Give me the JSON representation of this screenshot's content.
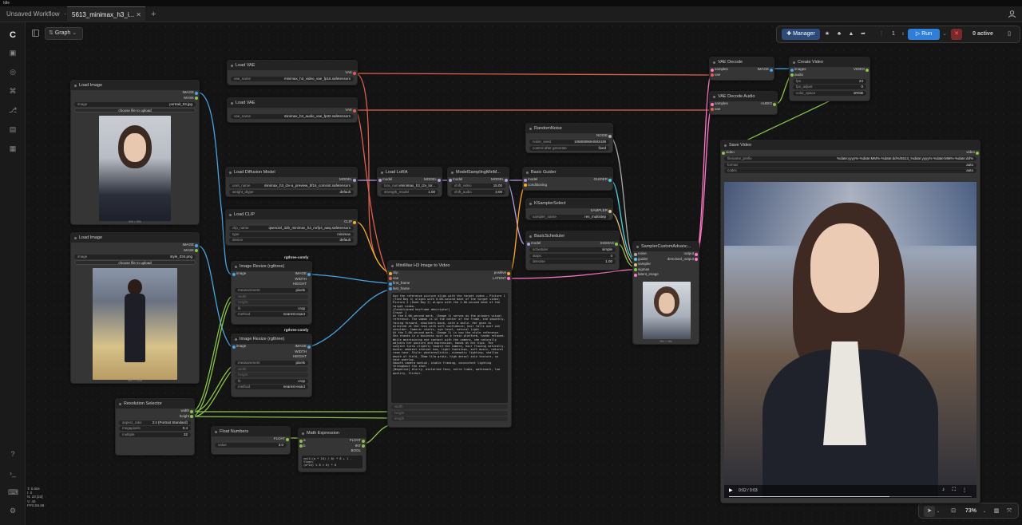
{
  "app": {
    "status": "Idle"
  },
  "tabs": [
    {
      "label": "Unsaved Workflow",
      "modified": "●"
    },
    {
      "label": "5613_minimax_h3_i...",
      "close": "✕"
    }
  ],
  "new_tab_label": "+",
  "user_icon": "user-icon",
  "canvas_toolbar": {
    "graph_label": "Graph",
    "graph_chevron": "⌄"
  },
  "top_actions": {
    "manager_label": "Manager",
    "queue_count": "1",
    "run_label": "Run",
    "active_label": "0 active"
  },
  "zoom": {
    "percent": "73%"
  },
  "stats": [
    "T: 0.00s",
    "I: 0",
    "N: 23 [23]",
    "V: 40",
    "FPS:59.88"
  ],
  "nodes": {
    "load_image_1": {
      "title": "Load Image",
      "outputs": [
        "IMAGE",
        "MASK"
      ],
      "image_label": "image",
      "image_value": "portrait_03.jpg",
      "upload_label": "choose file to upload",
      "caption": "896 × 896"
    },
    "load_image_2": {
      "title": "Load Image",
      "outputs": [
        "IMAGE",
        "MASK"
      ],
      "image_label": "image",
      "image_value": "style_034.png",
      "upload_label": "choose file to upload",
      "caption": "960 × 1408"
    },
    "load_vae_1": {
      "title": "Load VAE",
      "output": "VAE",
      "label": "vae_name",
      "value": "minimax_h3_video_vae_fp16.safetensors"
    },
    "load_vae_2": {
      "title": "Load VAE",
      "output": "VAE",
      "label": "vae_name",
      "value": "minimax_h3_audio_vae_fp32.safetensors"
    },
    "load_diffusion": {
      "title": "Load Diffusion Model",
      "output": "MODEL",
      "w1_label": "unet_name",
      "w1_value": "minimax_h3_i2v-a_preview_bf16_comsint.safetensors",
      "w2_label": "weight_dtype",
      "w2_value": "default"
    },
    "load_clip": {
      "title": "Load CLIP",
      "output": "CLIP",
      "w1_label": "clip_name",
      "w1_value": "qwen3vl_32b_minimax_h3_mrfp4_awq.safetensors",
      "w2_label": "type",
      "w2_value": "minimax",
      "w3_label": "device",
      "w3_value": "default"
    },
    "load_lora": {
      "title": "Load LoRA",
      "input": "model",
      "output": "MODEL",
      "w1_label": "lora_name",
      "w1_value": "minimax_h3_i2v_lor...",
      "w2_label": "strength_model",
      "w2_value": "1.00"
    },
    "model_sampling": {
      "title": "ModelSamplingMinM...",
      "input": "model",
      "output": "MODEL",
      "w1_label": "shift_video",
      "w1_value": "15.00",
      "w2_label": "shift_audio",
      "w2_value": "3.00"
    },
    "random_noise": {
      "title": "RandomNoise",
      "output": "NOISE",
      "w1_label": "noise_seed",
      "w1_value": "1068089694593439",
      "w2_label": "control after generate",
      "w2_value": "fixed"
    },
    "basic_guider": {
      "title": "Basic Guider",
      "inputs": [
        "model",
        "conditioning"
      ],
      "output": "GUIDER"
    },
    "ksampler_select": {
      "title": "KSamplerSelect",
      "output": "SAMPLER",
      "w1_label": "sampler_name",
      "w1_value": "res_multistep"
    },
    "basic_scheduler": {
      "title": "BasicScheduler",
      "input": "model",
      "output": "SIGMAS",
      "w1_label": "scheduler",
      "w1_value": "simple",
      "w2_label": "steps",
      "w2_value": "4",
      "w3_label": "denoise",
      "w3_value": "1.00"
    },
    "sampler_custom": {
      "title": "SamplerCustomAdvanc...",
      "inputs": [
        "noise",
        "guider",
        "sampler",
        "sigmas",
        "latent_image"
      ],
      "outputs": [
        "output",
        "denoised_output"
      ],
      "caption": "384 × 384"
    },
    "vae_decode": {
      "title": "VAE Decode",
      "inputs": [
        "samples",
        "vae"
      ],
      "output": "IMAGE"
    },
    "vae_decode_audio": {
      "title": "VAE Decode Audio",
      "inputs": [
        "samples",
        "vae"
      ],
      "output": "AUDIO"
    },
    "create_video": {
      "title": "Create Video",
      "inputs": [
        "images",
        "audio"
      ],
      "output": "VIDEO",
      "w1_label": "fps",
      "w1_value": "24",
      "w2_label": "fps_adjust",
      "w2_value": "0",
      "w3_label": "color_space",
      "w3_value": "sRGB"
    },
    "save_video": {
      "title": "Save Video",
      "input": "video",
      "output": "video",
      "w1_label": "filename_prefix",
      "w1_value": "%date:yyyy%-%date:MM%-%date:dd%/5613_%date:yyyy%-%date:MM%-%date:dd%",
      "w2_label": "format",
      "w2_value": "auto",
      "w3_label": "codec",
      "w3_value": "auto",
      "time": "0:02 / 0:03"
    },
    "image_resize_1": {
      "title": "Image Resize (rgthree)",
      "badge": "rgthree-comfy",
      "input": "image",
      "outputs": [
        "IMAGE",
        "WIDTH",
        "HEIGHT"
      ],
      "w1_label": "measurement",
      "w1_value": "pixels",
      "w2_label": "width",
      "w3_label": "height",
      "w4_label": "fit",
      "w4_value": "crop",
      "w5_label": "method",
      "w5_value": "nearest-exact"
    },
    "image_resize_2": {
      "title": "Image Resize (rgthree)",
      "badge": "rgthree-comfy",
      "input": "image",
      "outputs": [
        "IMAGE",
        "WIDTH",
        "HEIGHT"
      ],
      "w1_label": "measurement",
      "w1_value": "pixels",
      "w2_label": "width",
      "w3_label": "height",
      "w4_label": "fit",
      "w4_value": "crop",
      "w5_label": "method",
      "w5_value": "nearest-exact"
    },
    "resolution_selector": {
      "title": "Resolution Selector",
      "outputs": [
        "width",
        "height"
      ],
      "w1_label": "aspect_ratio",
      "w1_value": "3:4 (Portrait Standard)",
      "w2_label": "megapixels",
      "w2_value": "0.4",
      "w3_label": "multiple",
      "w3_value": "32"
    },
    "float_numbers": {
      "title": "Float Numbers",
      "output": "FLOAT",
      "w1_label": "value",
      "w1_value": "3.0"
    },
    "math_expression": {
      "title": "Math Expression",
      "inputs": [
        "a",
        "b"
      ],
      "outputs": [
        "FLOAT",
        "INT",
        "BOOL"
      ],
      "expression": "ceil((a * 24) / 8) * 8 + 1 - floor(\n(a*24) % 8 > 0) * 0"
    },
    "minimax": {
      "title": "MiniMax H3 Image to Video",
      "inputs": [
        "clip",
        "vae",
        "first_frame",
        "last_frame"
      ],
      "outputs": [
        "positive",
        "LATENT"
      ],
      "extra_inputs": [
        "width",
        "height",
        "length"
      ],
      "prompt": "Use the reference picture align with the target video — Picture 1 (Tied Bay 4) aligns with 0.00-second beat of the target video; Picture 2 (Used Bay 2) aligns with the 2.00-second beat of the target video.\n[Conditioned keyframe descriptor]\nCrowd: 1\nAt the 0.00-second mark, (Image 1) serves as the primary visual reference. The woman is in the center of the frame, she smoothly, facing forward, shoulders back, with a smile. Her gaze is directed at the lens with soft confidence; hair falls over one shoulder. Camera: static, eye level, natural light.\nAt the 2.00-second mark, (Image 2) is now the style reference. She stands in a business suit on a train platform, hands relaxed. While maintaining eye contact with the camera, she naturally adjusts her posture and expression, hands at her hips. The subject turns slightly toward the camera, hair flowing naturally.\nAudio: ambient station hum, light footsteps, soft music, natural room tone. Style: photorealistic, cinematic lighting, shallow depth of field, 35mm film grain, high detail skin texture, no text overlay.\nSmooth camera motion, stable framing, consistent lighting throughout the shot.\n[Negative] blurry, distorted face, extra limbs, watermark, low quality, flicker."
    }
  }
}
